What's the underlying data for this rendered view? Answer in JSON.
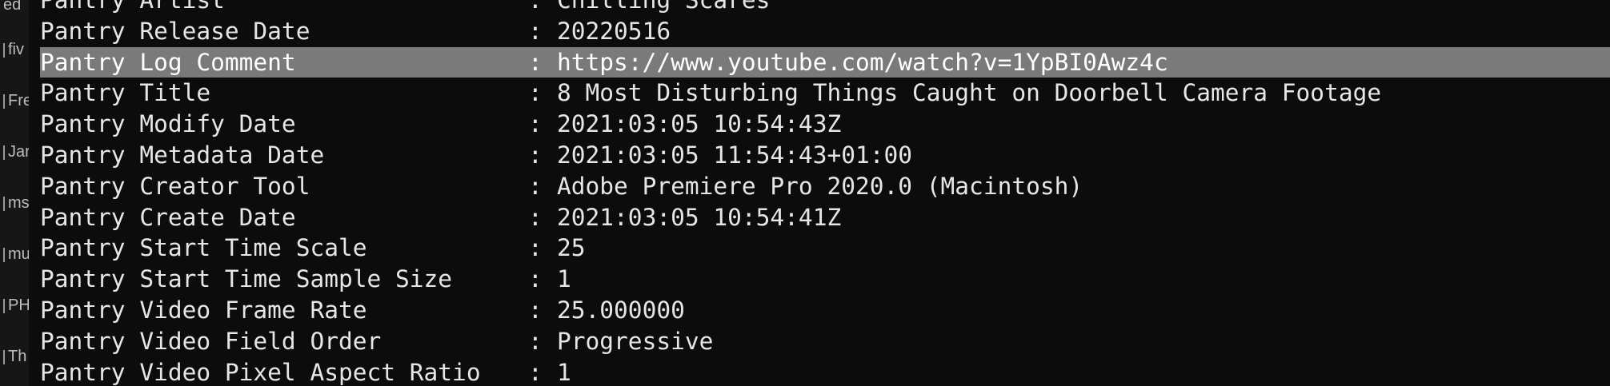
{
  "sidebar": {
    "items": [
      {
        "label": "ed"
      },
      {
        "label": "fiv"
      },
      {
        "label": "Fre"
      },
      {
        "label": "Jar"
      },
      {
        "label": "ms"
      },
      {
        "label": "mu"
      },
      {
        "label": "PH"
      },
      {
        "label": "Th"
      }
    ]
  },
  "terminal": {
    "separator": ":",
    "rows": [
      {
        "key": "Pantry Artist",
        "value": "Chilling Scares"
      },
      {
        "key": "Pantry Release Date",
        "value": "20220516"
      },
      {
        "key": "Pantry Log Comment",
        "value": "https://www.youtube.com/watch?v=1YpBI0Awz4c",
        "selected": true
      },
      {
        "key": "Pantry Title",
        "value": "8 Most Disturbing Things Caught on Doorbell Camera Footage"
      },
      {
        "key": "Pantry Modify Date",
        "value": "2021:03:05 10:54:43Z"
      },
      {
        "key": "Pantry Metadata Date",
        "value": "2021:03:05 11:54:43+01:00"
      },
      {
        "key": "Pantry Creator Tool",
        "value": "Adobe Premiere Pro 2020.0 (Macintosh)"
      },
      {
        "key": "Pantry Create Date",
        "value": "2021:03:05 10:54:41Z"
      },
      {
        "key": "Pantry Start Time Scale",
        "value": "25"
      },
      {
        "key": "Pantry Start Time Sample Size",
        "value": "1"
      },
      {
        "key": "Pantry Video Frame Rate",
        "value": "25.000000"
      },
      {
        "key": "Pantry Video Field Order",
        "value": "Progressive"
      },
      {
        "key": "Pantry Video Pixel Aspect Ratio",
        "value": "1"
      }
    ]
  },
  "colors": {
    "background": "#0c0c0c",
    "text": "#e6e6e6",
    "selection": "#7a7a7a"
  }
}
